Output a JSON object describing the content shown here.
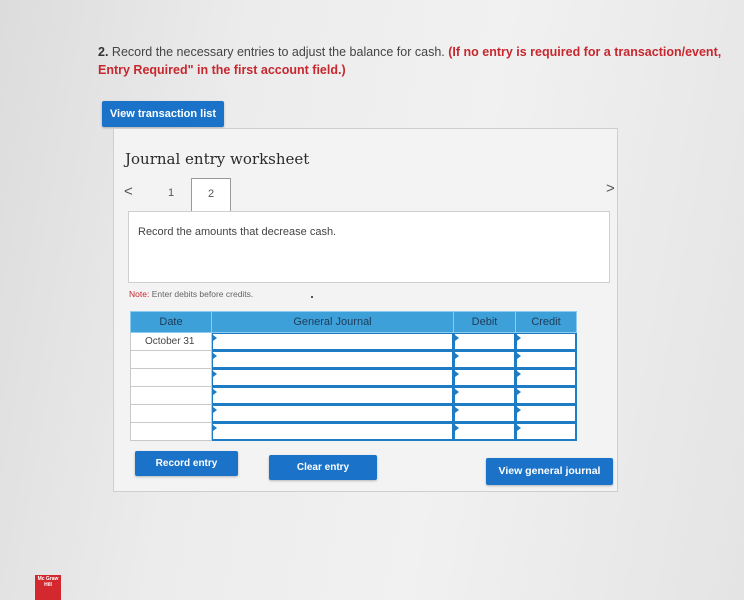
{
  "question": {
    "number": "2.",
    "text": "Record the necessary entries to adjust the balance for cash.",
    "emphasis": "(If no entry is required for a transaction/event,",
    "emphasis_line2": "Entry Required\" in the first account field.)"
  },
  "buttons": {
    "view_transaction_list": "View transaction list",
    "record_entry": "Record entry",
    "clear_entry": "Clear entry",
    "view_general_journal": "View general journal"
  },
  "worksheet": {
    "title": "Journal entry worksheet",
    "prev_icon": "chevron-left-icon",
    "next_icon": "chevron-right-icon",
    "prev_glyph": "<",
    "next_glyph": ">",
    "pages": [
      "1",
      "2"
    ],
    "current_page": "2",
    "instruction": "Record the amounts that decrease cash.",
    "note_label": "Note:",
    "note_text": "Enter debits before credits."
  },
  "journal_table": {
    "columns": [
      "Date",
      "General Journal",
      "Debit",
      "Credit"
    ],
    "rows": [
      {
        "date": "October 31",
        "account": "",
        "debit": "",
        "credit": ""
      },
      {
        "date": "",
        "account": "",
        "debit": "",
        "credit": ""
      },
      {
        "date": "",
        "account": "",
        "debit": "",
        "credit": ""
      },
      {
        "date": "",
        "account": "",
        "debit": "",
        "credit": ""
      },
      {
        "date": "",
        "account": "",
        "debit": "",
        "credit": ""
      },
      {
        "date": "",
        "account": "",
        "debit": "",
        "credit": ""
      }
    ]
  },
  "logo": {
    "text": "Mc Graw Hill",
    "color": "#d2282e"
  },
  "colors": {
    "accent": "#1a73c9",
    "header": "#3da0d8",
    "emphasis": "#c7272e"
  }
}
